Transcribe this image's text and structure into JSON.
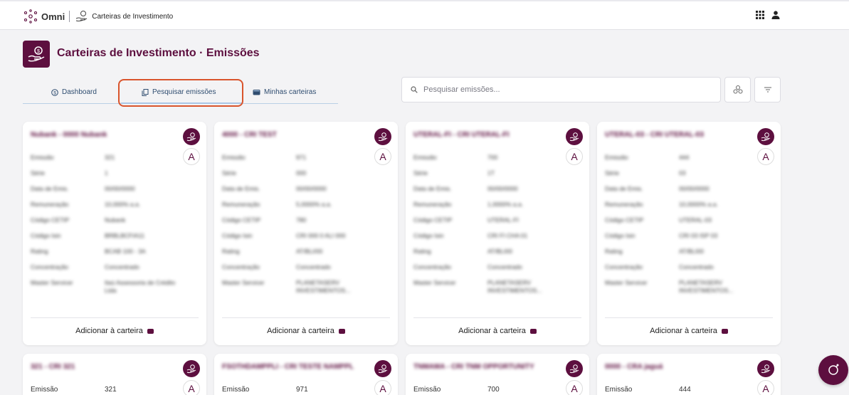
{
  "header": {
    "brand": "Omni",
    "app_name": "Carteiras de Investimento"
  },
  "page": {
    "title": "Carteiras de Investimento · Emissões"
  },
  "tabs": [
    {
      "label": "Dashboard",
      "icon": "dollar-circle-icon"
    },
    {
      "label": "Pesquisar emissões",
      "icon": "document-copy-icon",
      "active": true
    },
    {
      "label": "Minhas carteiras",
      "icon": "wallet-icon"
    }
  ],
  "search": {
    "placeholder": "Pesquisar emissões..."
  },
  "labels": {
    "emissao": "Emissão",
    "serie": "Série",
    "data_emissao": "Data de Emis.",
    "remuneracao": "Remuneração",
    "codigo_cetip": "Código CETIP",
    "codigo_isin": "Código Isin",
    "rating": "Rating",
    "concentracao": "Concentração",
    "agente": "Master Servicer",
    "add_to_wallet": "Adicionar à carteira"
  },
  "cards": [
    {
      "title": "Nubank - 0000 Nubank",
      "emissao": "321",
      "serie": "1",
      "data": "00/00/0000",
      "remun": "10,000% a.a.",
      "cetip": "Nubank",
      "isin": "BRBLBCFIA11",
      "rating": "BCAB 100 - 3A",
      "concentracao": "Concentrado",
      "agente": "Itaú Assessoria de Crédito Ltda"
    },
    {
      "title": "4000 - CRI TEST",
      "emissao": "971",
      "serie": "000",
      "data": "00/00/0000",
      "remun": "5,0000% a.a.",
      "cetip": "780",
      "isin": "CRI 000 0 ALI 000",
      "rating": "AT/BLI/00",
      "concentracao": "Concentrado",
      "agente": "PLANETASERV INVESTIMENTOS..."
    },
    {
      "title": "UTERAL-FI - CRI UTERAL-FI",
      "emissao": "700",
      "serie": "1T",
      "data": "00/00/0000",
      "remun": "1,0000% a.a.",
      "cetip": "UTERAL-FI",
      "isin": "CRI FI CHA 01",
      "rating": "AT/BLI00",
      "concentracao": "Concentrado",
      "agente": "PLANETASERV INVESTIMENTOS..."
    },
    {
      "title": "UTERAL-03 - CRI UTERAL-03",
      "emissao": "444",
      "serie": "03",
      "data": "00/00/0000",
      "remun": "10,0000% a.a.",
      "cetip": "UTERAL-03",
      "isin": "CRI 03 ISP 03",
      "rating": "AT/BLI00",
      "concentracao": "Concentrado",
      "agente": "PLANETASERV INVESTIMENTOS..."
    },
    {
      "title": "321 - CRI 321",
      "emissao": "321"
    },
    {
      "title": "FSOTHDAMPPLI - CRI TESTE NAMPPL",
      "emissao": "971"
    },
    {
      "title": "TNMAMA - CRI TNM OPPORTUNITY",
      "emissao": "700"
    },
    {
      "title": "0000 - CRA jaguá",
      "emissao": "444"
    }
  ]
}
